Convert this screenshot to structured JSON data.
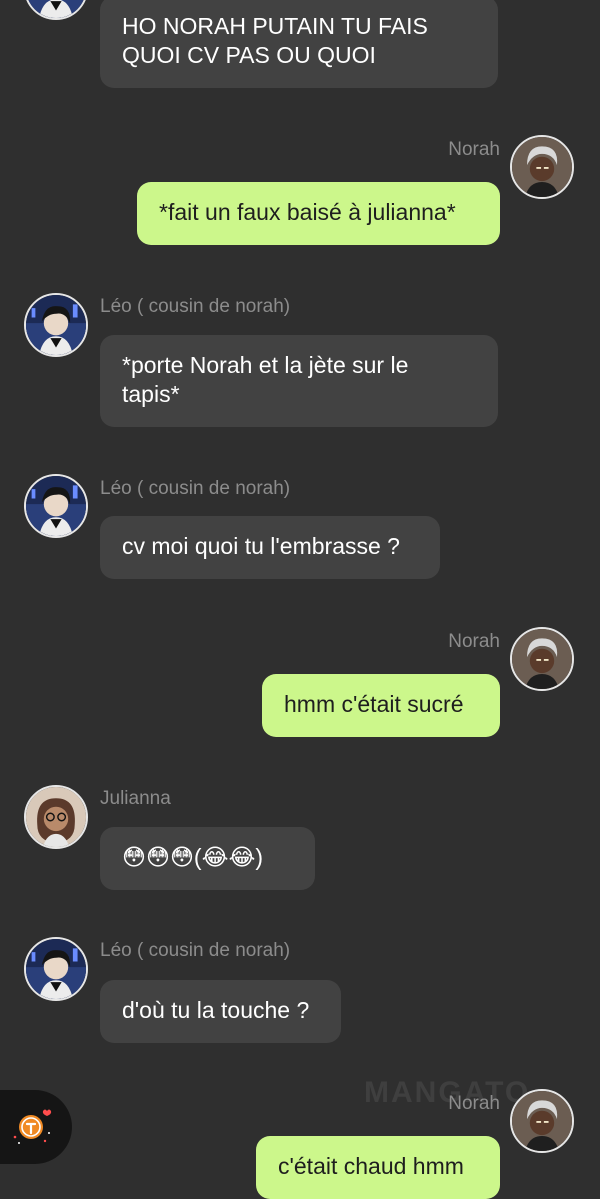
{
  "messages": [
    {
      "sender": "",
      "side": "other",
      "avatar": "leo-avatar",
      "text": "HO NORAH PUTAIN TU FAIS\nQUOI CV PAS OU QUOI"
    },
    {
      "sender": "Norah",
      "side": "self",
      "avatar": "norah-avatar",
      "text": "*fait un faux baisé à julianna*"
    },
    {
      "sender": "Léo ( cousin de norah)",
      "side": "other",
      "avatar": "leo-avatar",
      "text": "*porte Norah et la jète sur le\ntapis*"
    },
    {
      "sender": "Léo ( cousin de norah)",
      "side": "other",
      "avatar": "leo-avatar",
      "text": "cv moi quoi tu l'embrasse ?"
    },
    {
      "sender": "Norah",
      "side": "self",
      "avatar": "norah-avatar",
      "text": "hmm c'était sucré"
    },
    {
      "sender": "Julianna",
      "side": "other",
      "avatar": "julianna-avatar",
      "text": "😳😳😳(😂😂)"
    },
    {
      "sender": "Léo ( cousin de norah)",
      "side": "other",
      "avatar": "leo-avatar",
      "text": "d'où tu la touche ?"
    },
    {
      "sender": "Norah",
      "side": "self",
      "avatar": "norah-avatar",
      "text": "c'était chaud hmm"
    }
  ],
  "watermark": "MANGATO",
  "colors": {
    "background": "#2f2f2f",
    "other_bubble": "#424242",
    "self_bubble": "#ccf78b",
    "name_text": "#8c8c8c"
  }
}
